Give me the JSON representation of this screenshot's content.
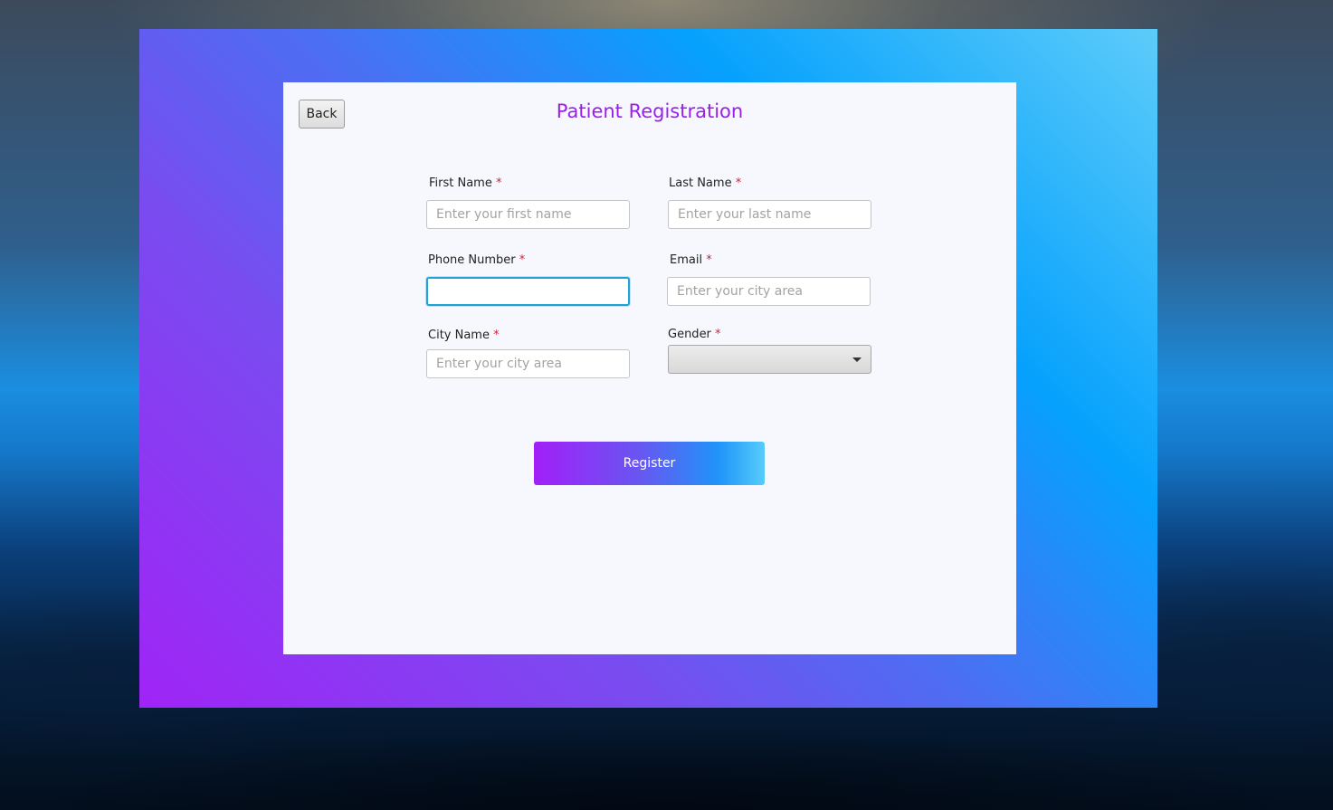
{
  "window": {
    "title": "Patient Registration"
  },
  "toolbar": {
    "back_label": "Back"
  },
  "form": {
    "required_marker": "*",
    "first_name": {
      "label": "First Name",
      "placeholder": "Enter your first name",
      "value": ""
    },
    "last_name": {
      "label": "Last Name",
      "placeholder": "Enter your last name",
      "value": ""
    },
    "phone_number": {
      "label": "Phone Number",
      "placeholder": "",
      "value": "",
      "focused": true
    },
    "email": {
      "label": "Email",
      "placeholder": "Enter your city area",
      "value": ""
    },
    "city_name": {
      "label": "City Name",
      "placeholder": "Enter your city area",
      "value": ""
    },
    "gender": {
      "label": "Gender",
      "selected": "",
      "icon": "chevron-down-icon"
    },
    "register_label": "Register"
  },
  "colors": {
    "title": "#9b1fe8",
    "required": "#d6213a",
    "focus_border": "#1fa3d6",
    "gradient_start": "#a024f6",
    "gradient_end": "#5dccf9"
  }
}
